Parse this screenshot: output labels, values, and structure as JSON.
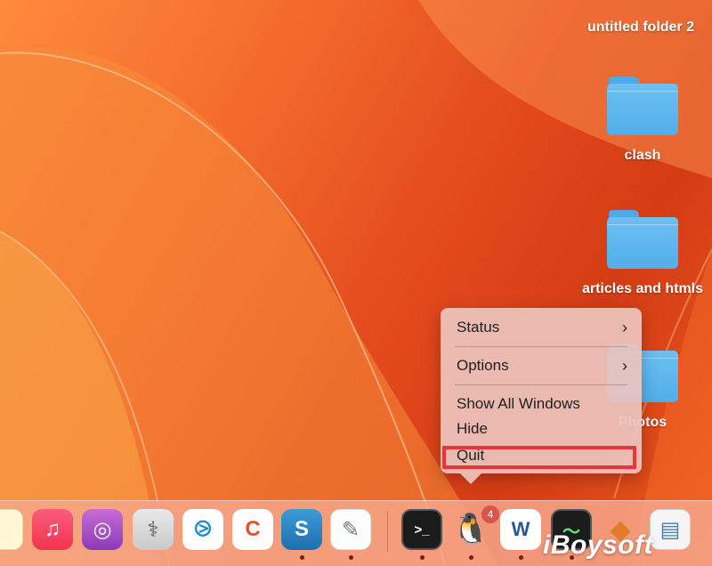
{
  "desktop": {
    "items": [
      {
        "label": "untitled folder 2",
        "icon": "folder-icon"
      },
      {
        "label": "clash",
        "icon": "folder-icon"
      },
      {
        "label": "articles and htmls",
        "icon": "folder-icon"
      },
      {
        "label": "Photos",
        "icon": "folder-icon"
      }
    ]
  },
  "context_menu": {
    "items": [
      {
        "label": "Status",
        "submenu": true
      },
      {
        "label": "Options",
        "submenu": true
      },
      {
        "label": "Show All Windows"
      },
      {
        "label": "Hide"
      },
      {
        "label": "Quit"
      }
    ],
    "chevron": "›"
  },
  "dock": {
    "apps": [
      {
        "name": "notes-icon"
      },
      {
        "name": "music-icon",
        "glyph": "♫"
      },
      {
        "name": "podcasts-icon",
        "glyph": "◎"
      },
      {
        "name": "disk-utility-icon",
        "glyph": "⚕"
      },
      {
        "name": "vscode-icon",
        "glyph": "⧁"
      },
      {
        "name": "creative-cloud-icon",
        "glyph": "C"
      },
      {
        "name": "snagit-icon",
        "glyph": "S"
      },
      {
        "name": "textedit-icon",
        "glyph": "✎"
      },
      {
        "name": "terminal-icon",
        "glyph": ">_"
      },
      {
        "name": "qq-penguin-icon",
        "glyph": "🐧"
      },
      {
        "name": "word-icon",
        "glyph": "W"
      },
      {
        "name": "activity-monitor-icon",
        "glyph": "〜"
      },
      {
        "name": "installer-icon",
        "glyph": "◆"
      },
      {
        "name": "preview-icon",
        "glyph": "▤"
      }
    ],
    "badge_count": "4"
  },
  "watermark": "iBoysoft",
  "colors": {
    "highlight_border": "#e8353a",
    "menu_bg": "#ecc4be",
    "folder_blue": "#5ab4ec"
  }
}
